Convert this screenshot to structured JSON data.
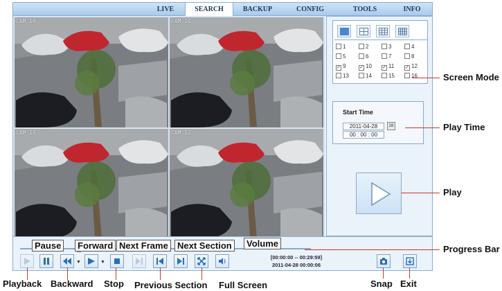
{
  "nav": {
    "tabs": [
      {
        "label": "LIVE"
      },
      {
        "label": "SEARCH"
      },
      {
        "label": "BACKUP"
      },
      {
        "label": "CONFIG"
      },
      {
        "label": "TOOLS"
      },
      {
        "label": "INFO"
      }
    ],
    "active": "SEARCH"
  },
  "cameras": [
    {
      "label": "CAM 09"
    },
    {
      "label": "CAM 10"
    },
    {
      "label": "CAM 11"
    },
    {
      "label": "CAM 12"
    }
  ],
  "screen_mode": {
    "channels": [
      {
        "label": "1",
        "checked": false
      },
      {
        "label": "2",
        "checked": false
      },
      {
        "label": "3",
        "checked": false
      },
      {
        "label": "4",
        "checked": false
      },
      {
        "label": "5",
        "checked": false
      },
      {
        "label": "6",
        "checked": false
      },
      {
        "label": "7",
        "checked": false
      },
      {
        "label": "8",
        "checked": false
      },
      {
        "label": "9",
        "checked": true
      },
      {
        "label": "10",
        "checked": true
      },
      {
        "label": "11",
        "checked": true
      },
      {
        "label": "12",
        "checked": true
      },
      {
        "label": "13",
        "checked": false
      },
      {
        "label": "14",
        "checked": false
      },
      {
        "label": "15",
        "checked": false
      },
      {
        "label": "16",
        "checked": false
      }
    ],
    "check_mark": "✓"
  },
  "start_time": {
    "title": "Start Time",
    "date": "2011-04-28",
    "time": "00 : 00 : 00",
    "calendar_label": "28"
  },
  "controls": {
    "time_range": "[00:00:00 -- 00:29:59]",
    "current_time": "2011-04-28 00:00:06"
  },
  "annotations": {
    "pause": "Pause",
    "forward": "Forward",
    "next_frame": "Next Frame",
    "next_section": "Next Section",
    "volume": "Volume",
    "playback": "Playback",
    "backward": "Backward",
    "stop": "Stop",
    "previous_section": "Previous Section",
    "full_screen": "Full Screen",
    "snap": "Snap",
    "exit": "Exit",
    "screen_mode": "Screen Mode",
    "play_time": "Play Time",
    "play": "Play",
    "progress_bar": "Progress Bar"
  },
  "colors": {
    "accent": "#2a6fb5",
    "annotation_line": "#c0392b"
  }
}
